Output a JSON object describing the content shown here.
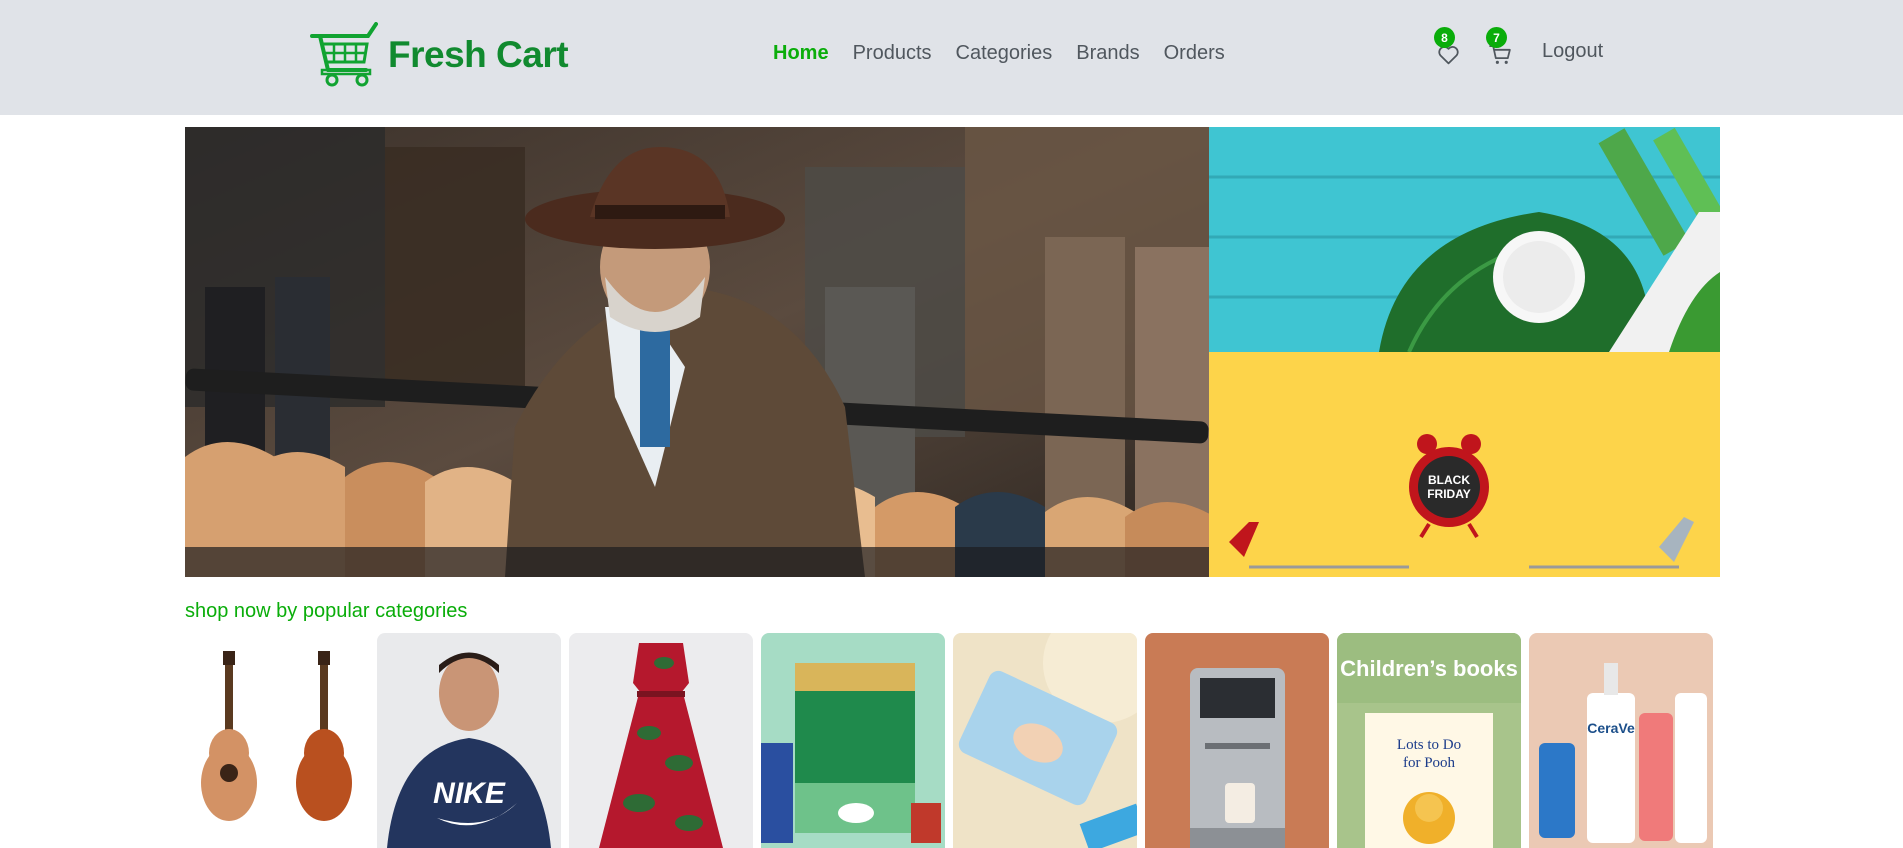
{
  "header": {
    "brand": "Fresh Cart",
    "nav": [
      {
        "label": "Home",
        "active": true
      },
      {
        "label": "Products",
        "active": false
      },
      {
        "label": "Categories",
        "active": false
      },
      {
        "label": "Brands",
        "active": false
      },
      {
        "label": "Orders",
        "active": false
      }
    ],
    "wishlist_count": "8",
    "cart_count": "7",
    "logout_label": "Logout",
    "icons": [
      "cart-logo-icon",
      "heart-icon",
      "cart-icon"
    ]
  },
  "hero": {
    "badge_text_line1": "BLACK",
    "badge_text_line2": "FRIDAY"
  },
  "categories": {
    "title": "shop now by popular categories",
    "book_label": "Children’s books",
    "book_title_line1": "Lots to Do",
    "book_title_line2": "for Pooh",
    "tshirt_brand": "NIKE",
    "skincare_brand": "CeraVe"
  },
  "colors": {
    "accent": "#0aad0a",
    "brand": "#118a2f",
    "navbar_bg": "#e0e3e8",
    "nav_text": "#50575e"
  }
}
